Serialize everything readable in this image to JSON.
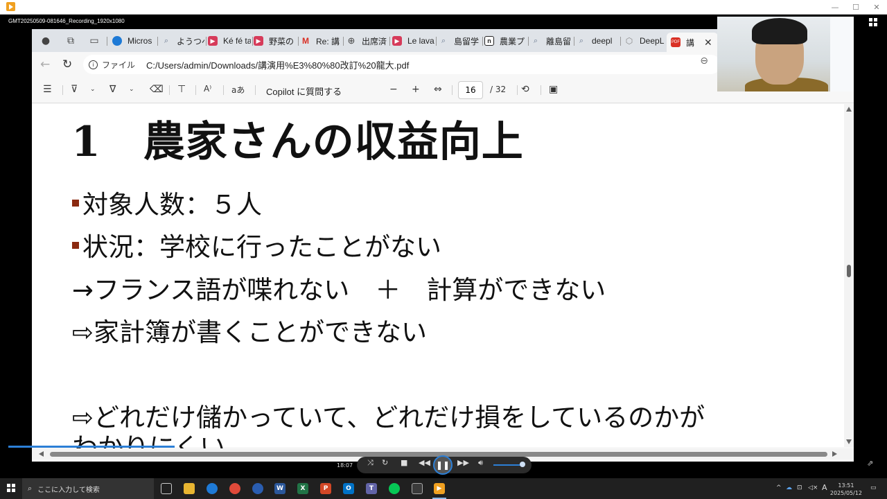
{
  "player": {
    "recording_title": "GMT20250509-081646_Recording_1920x1080",
    "time": "18:07",
    "win_min": "—",
    "win_max": "☐",
    "win_close": "✕"
  },
  "browser": {
    "tabs": [
      {
        "label": "Micros",
        "icon_color": "#1e7ad6"
      },
      {
        "label": "ようつべ",
        "icon_color": "#6b7a90"
      },
      {
        "label": "Ké fé ta",
        "icon_color": "#d63b5a"
      },
      {
        "label": "野菜の",
        "icon_color": "#d63b5a"
      },
      {
        "label": "Re: 講",
        "icon_color": "#d93025"
      },
      {
        "label": "出席済",
        "icon_color": "#444444"
      },
      {
        "label": "Le lava",
        "icon_color": "#d63b5a"
      },
      {
        "label": "島留学",
        "icon_color": "#6b7a90"
      },
      {
        "label": "農業プ",
        "icon_color": "#222222"
      },
      {
        "label": "離島留",
        "icon_color": "#6b7a90"
      },
      {
        "label": "deepl",
        "icon_color": "#6b7a90"
      },
      {
        "label": "DeepL",
        "icon_color": "#888888"
      },
      {
        "label": "講",
        "icon_color": "#d93025",
        "active": true
      }
    ],
    "address": {
      "scheme_label": "ファイル",
      "url": "C:/Users/admin/Downloads/講演用%E3%80%80改訂%20龍大.pdf"
    },
    "pdf_toolbar": {
      "copilot_label": "Copilot に質問する",
      "current_page": "16",
      "total_pages": "/ 32",
      "minus": "−",
      "plus": "+"
    }
  },
  "slide": {
    "title": "1　農家さんの収益向上",
    "line1": "対象人数：５人",
    "line2": "状況：学校に行ったことがない",
    "line3": "→フランス語が喋れない　＋　計算ができない",
    "line4": "⇨家計簿が書くことができない",
    "line5": "⇨どれだけ儲かっていて、どれだけ損をしているのかが",
    "line6": "わかりにくい"
  },
  "taskbar": {
    "search_placeholder": "ここに入力して検索",
    "clock_time": "13:51",
    "clock_date": "2025/05/12",
    "ime": "A"
  },
  "colors": {
    "accent": "#2c7fd6",
    "bullet": "#8b2a10"
  }
}
